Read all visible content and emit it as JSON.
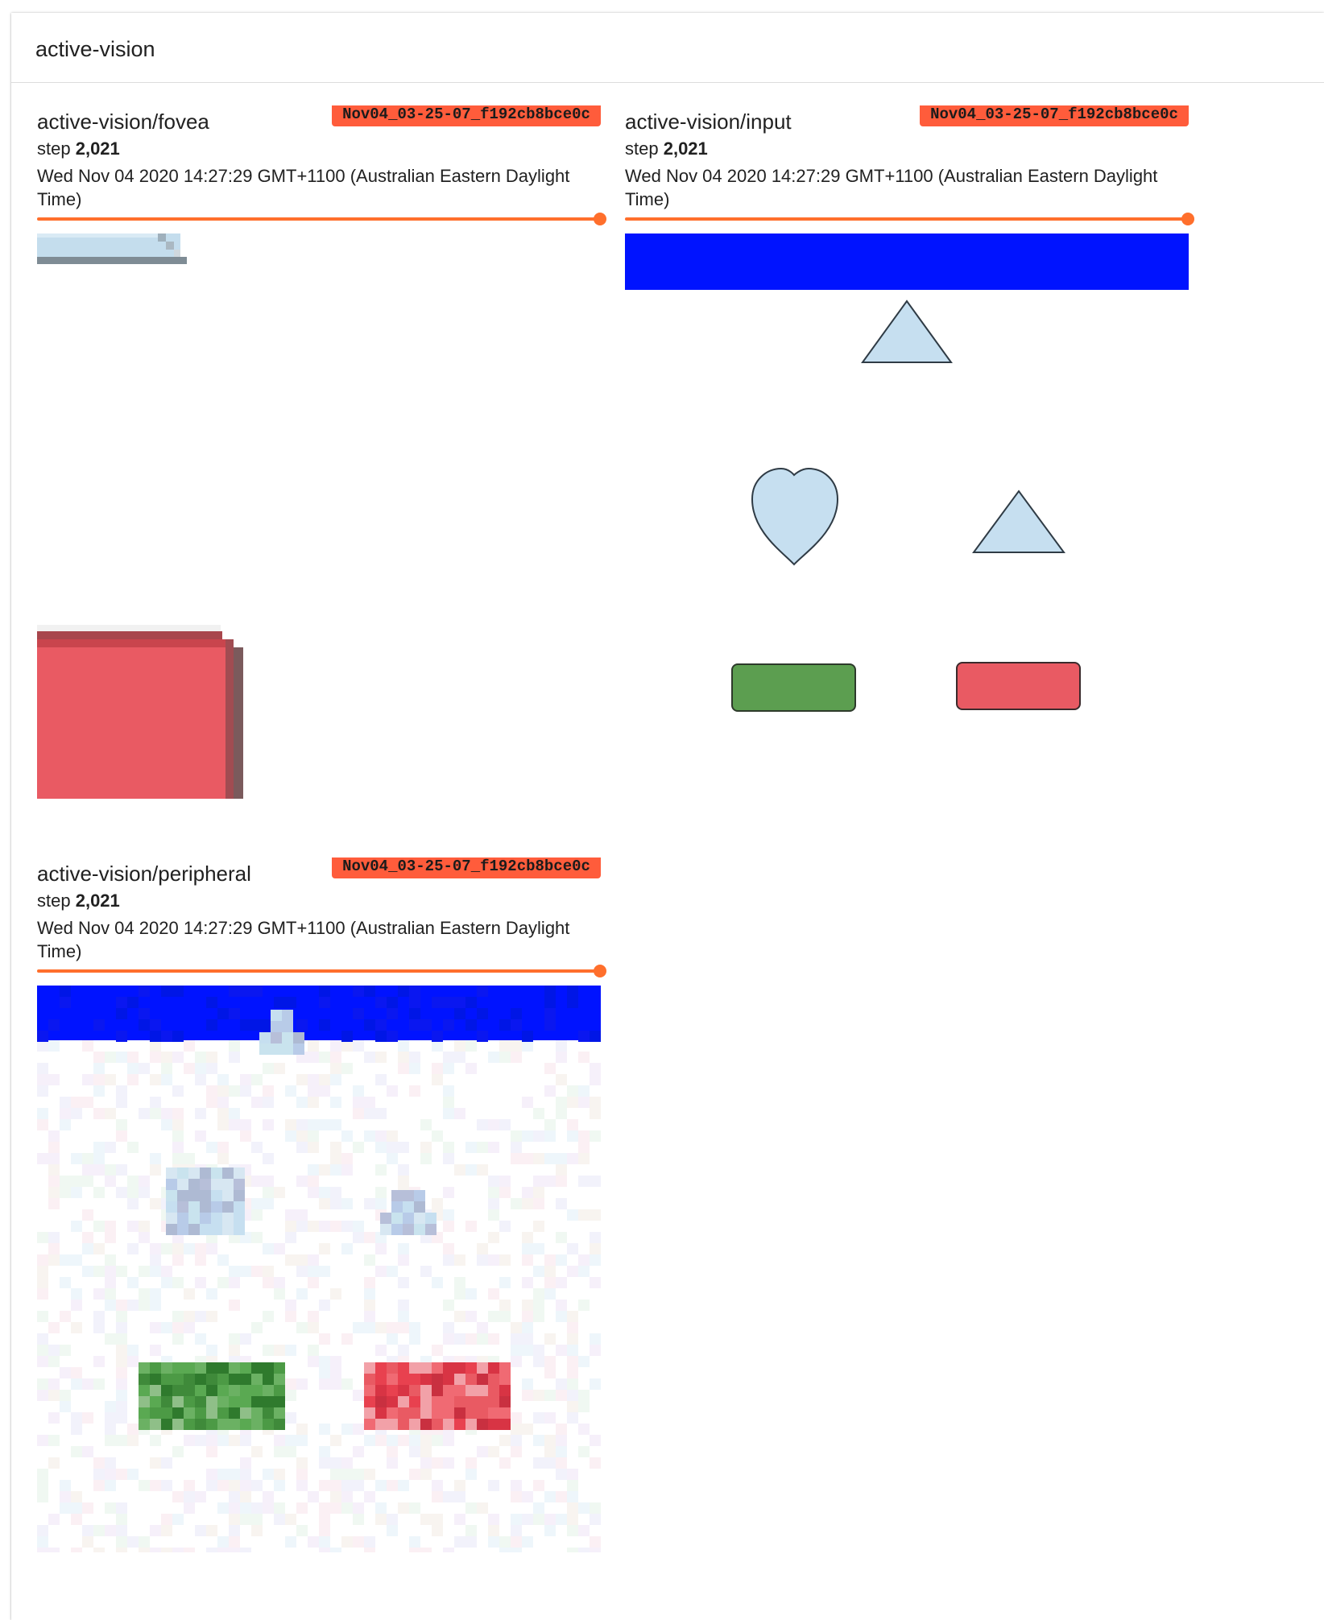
{
  "pane": {
    "title": "active-vision"
  },
  "cards": [
    {
      "title": "active-vision/fovea",
      "run": "Nov04_03-25-07_f192cb8bce0c",
      "step_label": "step",
      "step_value": "2,021",
      "timestamp": "Wed Nov 04 2020 14:27:29 GMT+1100 (Australian Eastern Daylight Time)",
      "step_slider": {
        "position": 1.0
      }
    },
    {
      "title": "active-vision/input",
      "run": "Nov04_03-25-07_f192cb8bce0c",
      "step_label": "step",
      "step_value": "2,021",
      "timestamp": "Wed Nov 04 2020 14:27:29 GMT+1100 (Australian Eastern Daylight Time)",
      "step_slider": {
        "position": 1.0
      }
    },
    {
      "title": "active-vision/peripheral",
      "run": "Nov04_03-25-07_f192cb8bce0c",
      "step_label": "step",
      "step_value": "2,021",
      "timestamp": "Wed Nov 04 2020 14:27:29 GMT+1100 (Australian Eastern Daylight Time)",
      "step_slider": {
        "position": 1.0
      }
    }
  ],
  "colors": {
    "accent": "#ff6f2c",
    "run_badge": "#ff5c3b",
    "image_header_blue": "#0013ff",
    "shape_light_blue": "#c6dff0",
    "shape_green": "#5c9e50",
    "shape_red": "#e95a63"
  }
}
